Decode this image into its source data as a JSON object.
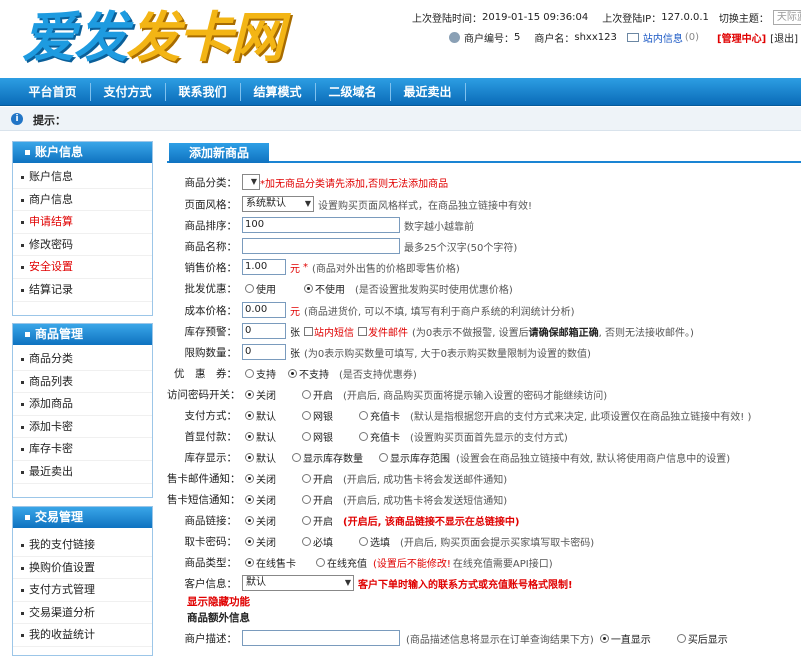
{
  "header": {
    "logo_part1": "爱发",
    "logo_part2": "发卡网",
    "last_login_time_label": "上次登陆时间：",
    "last_login_time": "2019-01-15 09:36:04",
    "last_login_ip_label": "上次登陆IP：",
    "last_login_ip": "127.0.0.1",
    "theme_label": "切换主题：",
    "theme_value": "天际蓝",
    "merchant_no_label": "商户编号：",
    "merchant_no": "5",
    "merchant_name_label": "商户名：",
    "merchant_name": "shxx123",
    "messages_label": "站内信息",
    "messages_count": "(0)",
    "admin_center": "[管理中心]",
    "logout": "[退出]"
  },
  "nav": [
    "平台首页",
    "支付方式",
    "联系我们",
    "结算模式",
    "二级域名",
    "最近卖出"
  ],
  "tip": {
    "label": "提示："
  },
  "sidebar": [
    {
      "title": "账户信息",
      "items": [
        {
          "label": "账户信息",
          "red": false
        },
        {
          "label": "商户信息",
          "red": false
        },
        {
          "label": "申请结算",
          "red": true
        },
        {
          "label": "修改密码",
          "red": false
        },
        {
          "label": "安全设置",
          "red": true
        },
        {
          "label": "结算记录",
          "red": false
        }
      ]
    },
    {
      "title": "商品管理",
      "items": [
        {
          "label": "商品分类",
          "red": false
        },
        {
          "label": "商品列表",
          "red": false
        },
        {
          "label": "添加商品",
          "red": false
        },
        {
          "label": "添加卡密",
          "red": false
        },
        {
          "label": "库存卡密",
          "red": false
        },
        {
          "label": "最近卖出",
          "red": false
        }
      ]
    },
    {
      "title": "交易管理",
      "items": [
        {
          "label": "我的支付链接",
          "red": false
        },
        {
          "label": "换购价值设置",
          "red": false
        },
        {
          "label": "支付方式管理",
          "red": false
        },
        {
          "label": "交易渠道分析",
          "red": false
        },
        {
          "label": "我的收益统计",
          "red": false
        }
      ]
    }
  ],
  "form": {
    "tab": "添加新商品",
    "category": {
      "label": "商品分类：",
      "hint": "*加无商品分类请先添加,否则无法添加商品"
    },
    "page_style": {
      "label": "页面风格：",
      "value": "系统默认",
      "note": "设置购买页面风格样式，在商品独立链接中有效!"
    },
    "sort": {
      "label": "商品排序：",
      "value": "100",
      "note": "数字越小越靠前"
    },
    "name": {
      "label": "商品名称：",
      "note": "最多25个汉字(50个字符)"
    },
    "price": {
      "label": "销售价格：",
      "value": "1.00",
      "unit": "元",
      "star": "*",
      "note": "(商品对外出售的价格即零售价格)"
    },
    "wholesale": {
      "label": "批发优惠：",
      "opt1": "使用",
      "opt2": "不使用",
      "note": "(是否设置批发购买时使用优惠价格)"
    },
    "cost": {
      "label": "成本价格：",
      "value": "0.00",
      "unit": "元",
      "note": "(商品进货价, 可以不填, 填写有利于商户系统的利润统计分析)"
    },
    "stock_alert": {
      "label": "库存预警：",
      "value": "0",
      "unit": "张",
      "chk1": "站内短信",
      "chk2": "发件邮件",
      "note_a": "(为0表示不做报警, 设置后",
      "note_b": "请确保邮箱正确",
      "note_c": ", 否则无法接收邮件。)"
    },
    "limit": {
      "label": "限购数量：",
      "value": "0",
      "unit": "张",
      "note": "(为0表示购买数量可填写, 大于0表示购买数量限制为设置的数值)"
    },
    "coupon": {
      "label": "优　惠　券：",
      "opt1": "支持",
      "opt2": "不支持",
      "note": "(是否支持优惠券)"
    },
    "access_pwd": {
      "label": "访问密码开关：",
      "opt1": "关闭",
      "opt2": "开启",
      "note": "(开启后, 商品购买页面将提示输入设置的密码才能继续访问)"
    },
    "payment": {
      "label": "支付方式：",
      "opt1": "默认",
      "opt2": "网银",
      "opt3": "充值卡",
      "note": "(默认是指根据您开启的支付方式来决定, 此项设置仅在商品独立链接中有效! )"
    },
    "first_pay": {
      "label": "首显付款：",
      "opt1": "默认",
      "opt2": "网银",
      "opt3": "充值卡",
      "note": "(设置购买页面首先显示的支付方式)"
    },
    "stock_display": {
      "label": "库存显示：",
      "opt1": "默认",
      "opt2": "显示库存数量",
      "opt3": "显示库存范围",
      "note": "(设置会在商品独立链接中有效, 默认将使用商户信息中的设置)"
    },
    "mail_notify": {
      "label": "售卡邮件通知：",
      "opt1": "关闭",
      "opt2": "开启",
      "note": "(开启后, 成功售卡将会发送邮件通知)"
    },
    "sms_notify": {
      "label": "售卡短信通知：",
      "opt1": "关闭",
      "opt2": "开启",
      "note": "(开启后, 成功售卡将会发送短信通知)"
    },
    "goods_link": {
      "label": "商品链接：",
      "opt1": "关闭",
      "opt2": "开启",
      "note": "(开启后, 该商品链接不显示在总链接中)"
    },
    "card_pwd": {
      "label": "取卡密码：",
      "opt1": "关闭",
      "opt2": "必填",
      "opt3": "选填",
      "note": "(开启后, 购买页面会提示买家填写取卡密码)"
    },
    "goods_type": {
      "label": "商品类型：",
      "opt1": "在线售卡",
      "opt2": "在线充值",
      "note_red": "(设置后不能修改!",
      "note_gray": "在线充值需要API接口)"
    },
    "customer_info": {
      "label": "客户信息：",
      "value": "默认",
      "note": "客户下单时输入的联系方式或充值账号格式限制!"
    },
    "hidden_feature": "显示隐藏功能",
    "extra_title": "商品额外信息",
    "description": {
      "label": "商户描述：",
      "note": "(商品描述信息将显示在订单查询结果下方)",
      "opt1": "一直显示",
      "opt2": "买后显示"
    }
  },
  "colors": {
    "brand_blue": "#1e9be0",
    "logo_gold": "#f3b515",
    "nav_blue": "#0a6bb8",
    "alert_red": "#e00000"
  }
}
